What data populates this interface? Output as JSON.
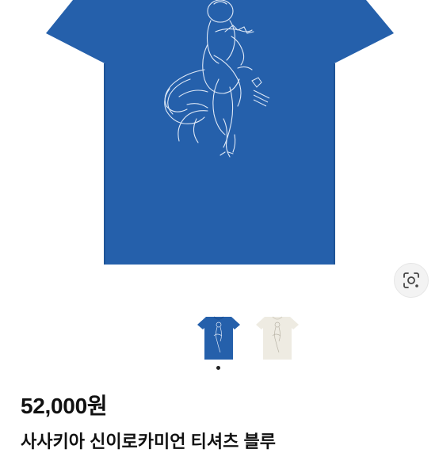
{
  "product": {
    "price": "52,000원",
    "title": "사사키아 신이로카미언 티셔츠 블루",
    "image_alt": "blue t-shirt with line drawing",
    "colors": {
      "shirt_blue": "#2560ab",
      "drawing": "#dfe9f7",
      "shirt_cream": "#eeebe2"
    }
  },
  "gallery": {
    "thumbnails": [
      {
        "label": "blue t-shirt"
      },
      {
        "label": "cream t-shirt"
      }
    ],
    "active_index": 0,
    "lens_icon": "visual-search-icon"
  }
}
